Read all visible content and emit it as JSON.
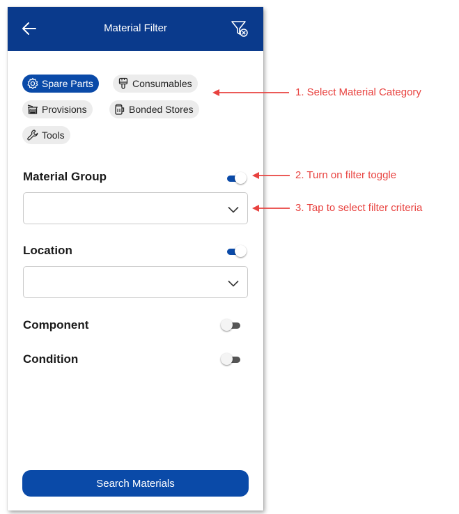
{
  "header": {
    "title": "Material Filter",
    "back_icon": "arrow-left-icon",
    "clear_icon": "filter-clear-icon"
  },
  "categories": {
    "items": [
      {
        "label": "Spare Parts",
        "icon": "gear-icon",
        "selected": true
      },
      {
        "label": "Consumables",
        "icon": "paint-brush-icon",
        "selected": false
      },
      {
        "label": "Provisions",
        "icon": "cooking-pot-icon",
        "selected": false
      },
      {
        "label": "Bonded Stores",
        "icon": "beer-mug-icon",
        "selected": false
      },
      {
        "label": "Tools",
        "icon": "wrench-icon",
        "selected": false
      }
    ]
  },
  "filters": {
    "material_group": {
      "label": "Material Group",
      "enabled": true,
      "value": ""
    },
    "location": {
      "label": "Location",
      "enabled": true,
      "value": ""
    },
    "component": {
      "label": "Component",
      "enabled": false
    },
    "condition": {
      "label": "Condition",
      "enabled": false
    }
  },
  "actions": {
    "search_label": "Search Materials"
  },
  "annotations": {
    "step1": "1. Select Material Category",
    "step2": "2. Turn on filter toggle",
    "step3": "3. Tap to select filter criteria"
  },
  "colors": {
    "header_bg": "#0a3a8c",
    "accent": "#0a4aa8",
    "annotation": "#e8423f"
  }
}
